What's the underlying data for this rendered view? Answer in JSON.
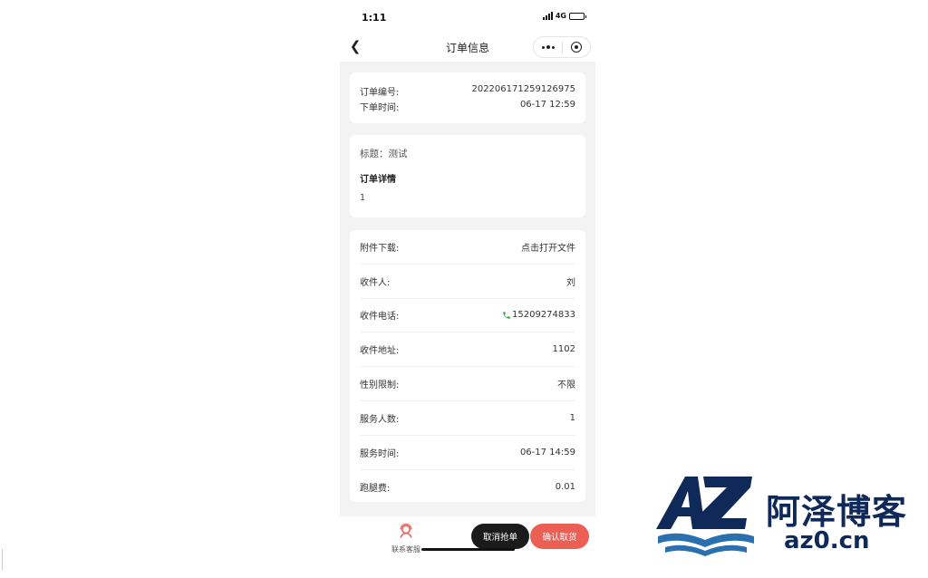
{
  "status_bar": {
    "time": "1:11",
    "network": "4G",
    "battery_level": 0.7
  },
  "nav": {
    "title": "订单信息"
  },
  "order_card": {
    "number_label": "订单编号:",
    "number_value": "202206171259126975",
    "time_label": "下单时间:",
    "time_value": "06-17 12:59"
  },
  "info_card": {
    "title_line": "标题：测试",
    "details_heading": "订单详情",
    "details_body": "1"
  },
  "detail_rows": [
    {
      "label": "附件下载:",
      "value": "点击打开文件"
    },
    {
      "label": "收件人:",
      "value": "刘"
    },
    {
      "label": "收件电话:",
      "value": "15209274833"
    },
    {
      "label": "收件地址:",
      "value": "1102"
    },
    {
      "label": "性别限制:",
      "value": "不限"
    },
    {
      "label": "服务人数:",
      "value": "1"
    },
    {
      "label": "服务时间:",
      "value": "06-17 14:59"
    },
    {
      "label": "跑腿费:",
      "value": "0.01"
    }
  ],
  "bottom_bar": {
    "customer_service_label": "联系客服",
    "cancel_button": "取消抢单",
    "confirm_button": "确认取货"
  },
  "watermark": {
    "logo_text": "AZ",
    "cn_text": "阿泽博客",
    "url": "az0.cn"
  },
  "colors": {
    "confirm_button": "#ec5f55",
    "cancel_button": "#1b1b1b",
    "phone_icon": "#3aa34a",
    "watermark": "#0f2a58",
    "page_bg": "#f3f3f3"
  }
}
